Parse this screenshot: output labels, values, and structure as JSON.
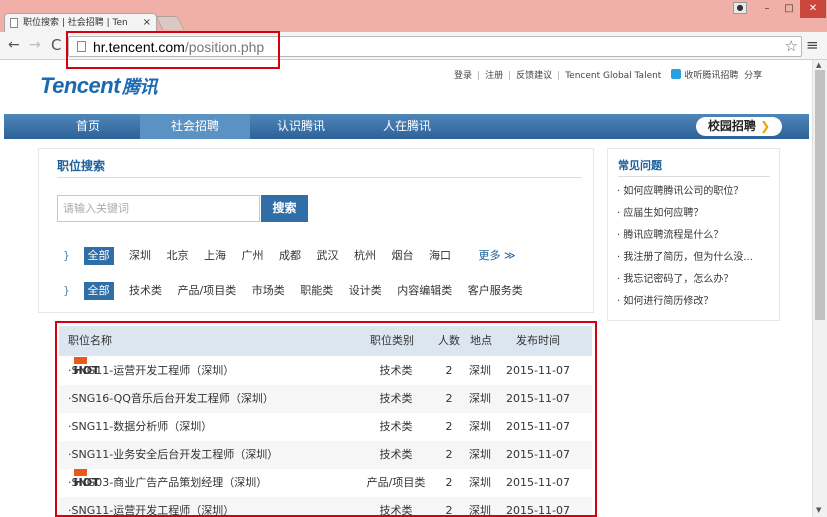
{
  "browser": {
    "tab_title": "职位搜索 | 社会招聘 | Ten",
    "url_host": "hr.tencent.com",
    "url_path": "/position.php",
    "nav": {
      "back": "←",
      "forward": "→",
      "reload": "C",
      "star": "☆",
      "menu": "≡"
    },
    "window": {
      "min": "–",
      "max": "□",
      "close": "✕"
    }
  },
  "header": {
    "logo_text": "Tencent",
    "logo_cn": "腾讯",
    "links": [
      "登录",
      "注册",
      "反馈建议",
      "Tencent Global Talent"
    ],
    "listen_link": "收听腾讯招聘",
    "share": "分享"
  },
  "nav": {
    "items": [
      "首页",
      "社会招聘",
      "认识腾讯",
      "人在腾讯"
    ],
    "active_index": 1,
    "campus": "校园招聘",
    "campus_arrow": "❯"
  },
  "search": {
    "title": "职位搜索",
    "placeholder": "请输入关键词",
    "button": "搜索",
    "cities": [
      "全部",
      "深圳",
      "北京",
      "上海",
      "广州",
      "成都",
      "武汉",
      "杭州",
      "烟台",
      "海口"
    ],
    "more": "更多",
    "categories": [
      "全部",
      "技术类",
      "产品/项目类",
      "市场类",
      "职能类",
      "设计类",
      "内容编辑类",
      "客户服务类"
    ]
  },
  "faq": {
    "title": "常见问题",
    "items": [
      "如何应聘腾讯公司的职位？",
      "应届生如何应聘？",
      "腾讯应聘流程是什么？",
      "我注册了简历，但为什么没...",
      "我忘记密码了，怎么办？",
      "如何进行简历修改？"
    ]
  },
  "jobs": {
    "headers": {
      "name": "职位名称",
      "category": "职位类别",
      "count": "人数",
      "location": "地点",
      "date": "发布时间"
    },
    "hot_label": "HOT",
    "rows": [
      {
        "name": "SNG11-运营开发工程师（深圳）",
        "hot": true,
        "category": "技术类",
        "count": "2",
        "location": "深圳",
        "date": "2015-11-07"
      },
      {
        "name": "SNG16-QQ音乐后台开发工程师（深圳）",
        "hot": false,
        "category": "技术类",
        "count": "2",
        "location": "深圳",
        "date": "2015-11-07"
      },
      {
        "name": "SNG11-数据分析师（深圳）",
        "hot": false,
        "category": "技术类",
        "count": "2",
        "location": "深圳",
        "date": "2015-11-07"
      },
      {
        "name": "SNG11-业务安全后台开发工程师（深圳）",
        "hot": false,
        "category": "技术类",
        "count": "2",
        "location": "深圳",
        "date": "2015-11-07"
      },
      {
        "name": "SNG03-商业广告产品策划经理（深圳）",
        "hot": true,
        "category": "产品/项目类",
        "count": "2",
        "location": "深圳",
        "date": "2015-11-07"
      },
      {
        "name": "SNG11-运营开发工程师（深圳）",
        "hot": false,
        "category": "技术类",
        "count": "2",
        "location": "深圳",
        "date": "2015-11-07"
      }
    ]
  },
  "colors": {
    "brand": "#1b6ab1",
    "nav": "#2d6299",
    "highlight": "#d7000f",
    "hot": "#e85a1b"
  }
}
